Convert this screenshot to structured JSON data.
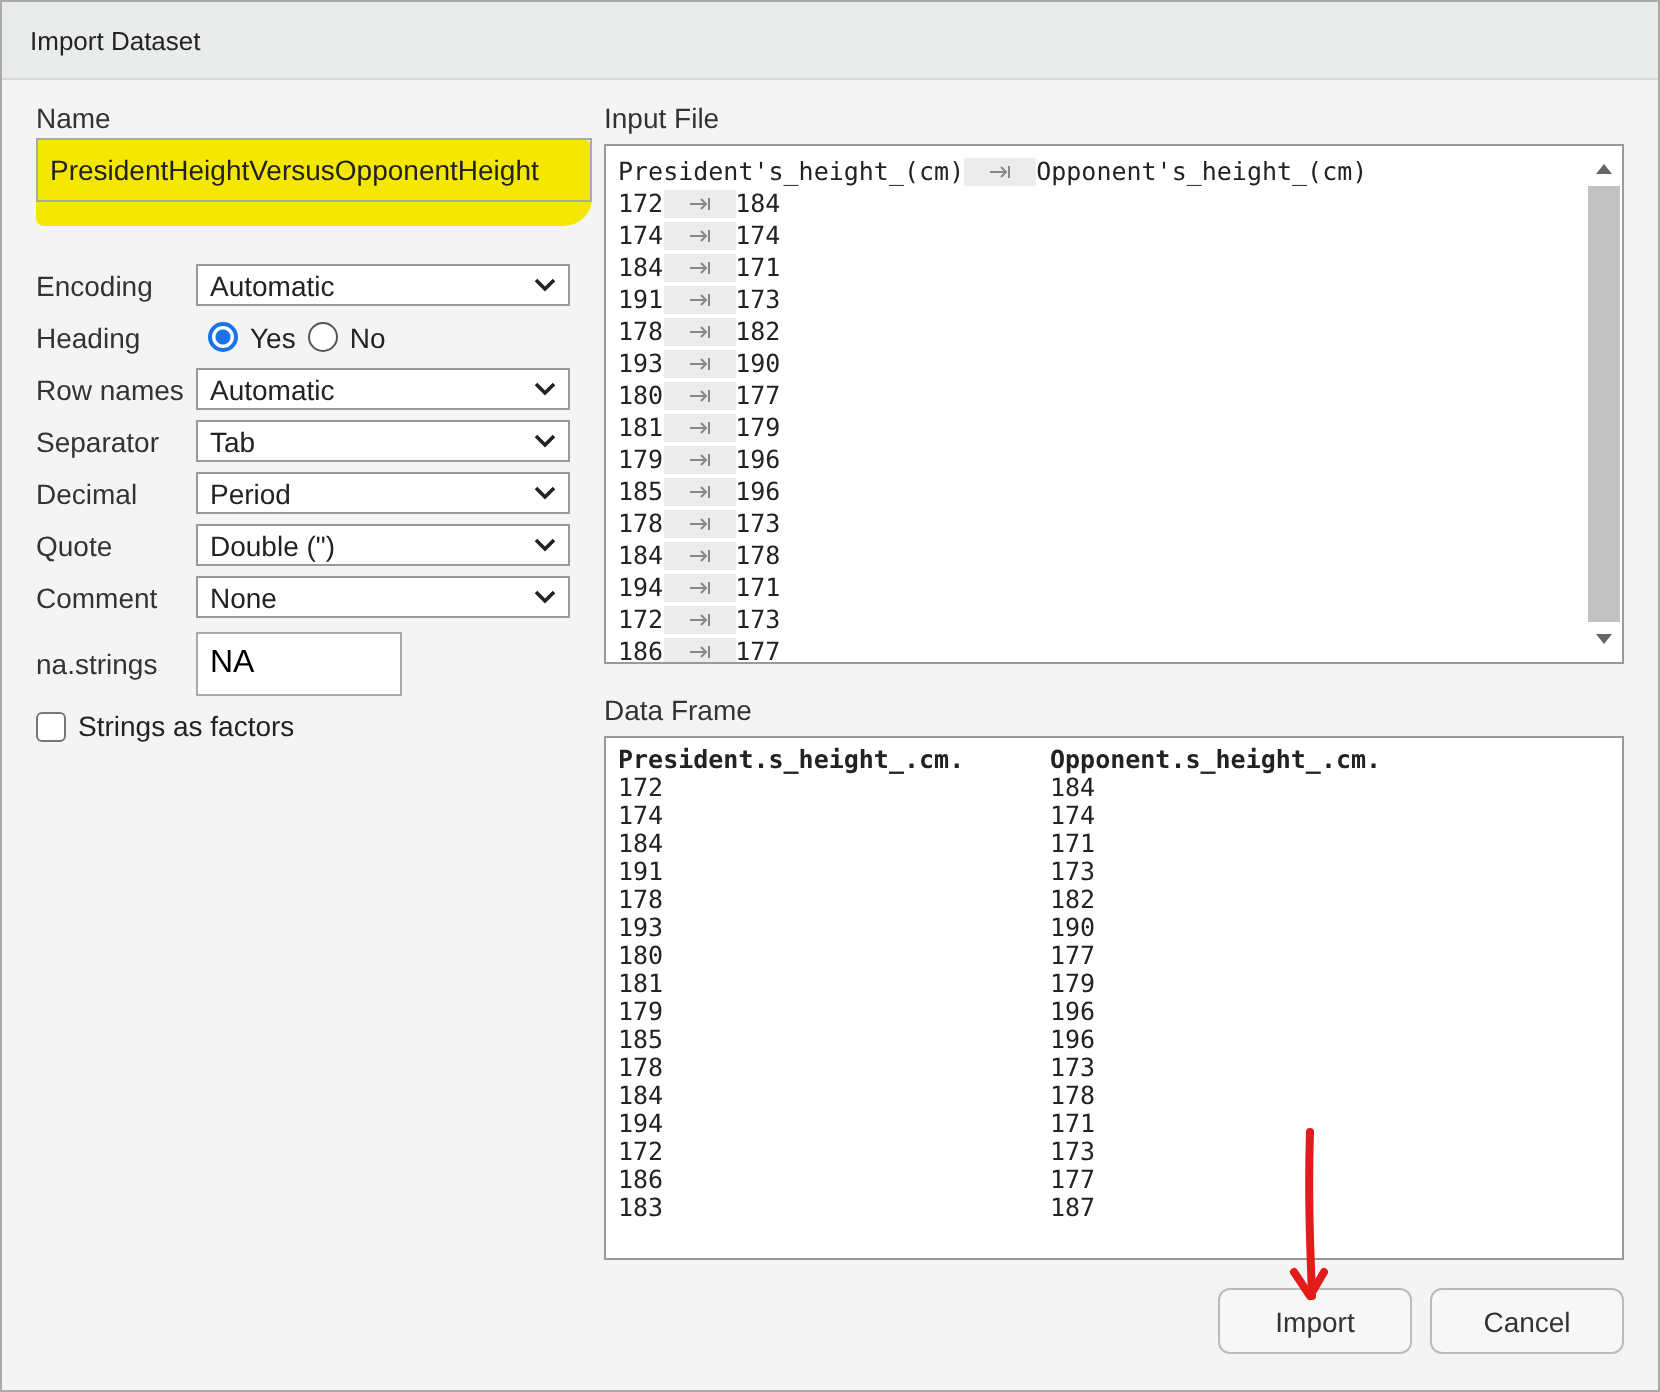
{
  "window": {
    "title": "Import Dataset"
  },
  "name": {
    "label": "Name",
    "value": "PresidentHeightVersusOpponentHeight",
    "highlighted": true
  },
  "options": [
    {
      "kind": "select",
      "label": "Encoding",
      "value": "Automatic"
    },
    {
      "kind": "radio",
      "label": "Heading",
      "choices": [
        {
          "label": "Yes",
          "selected": true
        },
        {
          "label": "No",
          "selected": false
        }
      ]
    },
    {
      "kind": "select",
      "label": "Row names",
      "value": "Automatic"
    },
    {
      "kind": "select",
      "label": "Separator",
      "value": "Tab"
    },
    {
      "kind": "select",
      "label": "Decimal",
      "value": "Period"
    },
    {
      "kind": "select",
      "label": "Quote",
      "value": "Double (\")"
    },
    {
      "kind": "select",
      "label": "Comment",
      "value": "None"
    },
    {
      "kind": "text",
      "label": "na.strings",
      "value": "NA"
    }
  ],
  "strings_as_factors": {
    "label": "Strings as factors",
    "checked": false
  },
  "input_file": {
    "title": "Input File",
    "lines": [
      [
        "President's_height_(cm)",
        "Opponent's_height_(cm)"
      ],
      [
        "172",
        "184"
      ],
      [
        "174",
        "174"
      ],
      [
        "184",
        "171"
      ],
      [
        "191",
        "173"
      ],
      [
        "178",
        "182"
      ],
      [
        "193",
        "190"
      ],
      [
        "180",
        "177"
      ],
      [
        "181",
        "179"
      ],
      [
        "179",
        "196"
      ],
      [
        "185",
        "196"
      ],
      [
        "178",
        "173"
      ],
      [
        "184",
        "178"
      ],
      [
        "194",
        "171"
      ],
      [
        "172",
        "173"
      ],
      [
        "186",
        "177"
      ]
    ]
  },
  "data_frame": {
    "title": "Data Frame",
    "columns": [
      "President.s_height_.cm.",
      "Opponent.s_height_.cm."
    ],
    "rows": [
      [
        "172",
        "184"
      ],
      [
        "174",
        "174"
      ],
      [
        "184",
        "171"
      ],
      [
        "191",
        "173"
      ],
      [
        "178",
        "182"
      ],
      [
        "193",
        "190"
      ],
      [
        "180",
        "177"
      ],
      [
        "181",
        "179"
      ],
      [
        "179",
        "196"
      ],
      [
        "185",
        "196"
      ],
      [
        "178",
        "173"
      ],
      [
        "184",
        "178"
      ],
      [
        "194",
        "171"
      ],
      [
        "172",
        "173"
      ],
      [
        "186",
        "177"
      ],
      [
        "183",
        "187"
      ]
    ]
  },
  "buttons": [
    "Import",
    "Cancel"
  ]
}
